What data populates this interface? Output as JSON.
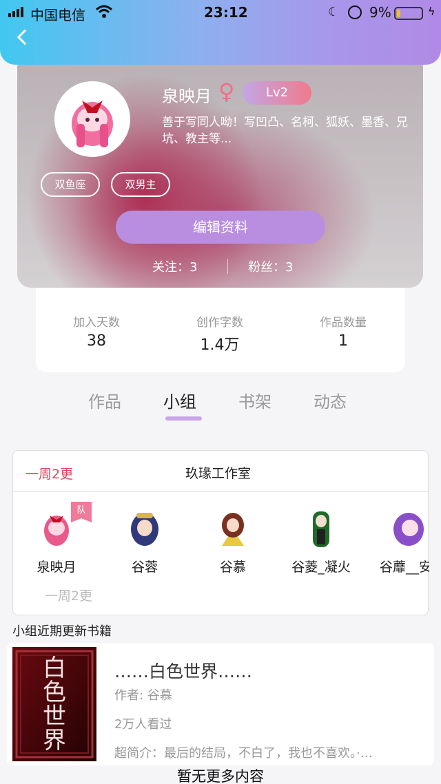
{
  "status_bar": {
    "carrier": "中国电信",
    "time": "23:12",
    "battery_percent": "9%"
  },
  "profile": {
    "name": "泉映月",
    "gender_symbol": "♀",
    "level": "Lv2",
    "bio": "善于写同人呦！写凹凸、名柯、狐妖、墨香、兄坑、教主等...",
    "tags": [
      "双鱼座",
      "双男主"
    ],
    "edit_label": "编辑资料",
    "following": "关注：3",
    "followers": "粉丝：3"
  },
  "stats": [
    {
      "label": "加入天数",
      "value": "38"
    },
    {
      "label": "创作字数",
      "value": "1.4万"
    },
    {
      "label": "作品数量",
      "value": "1"
    }
  ],
  "tabs": [
    {
      "label": "作品"
    },
    {
      "label": "小组"
    },
    {
      "label": "书架"
    },
    {
      "label": "动态"
    }
  ],
  "active_tab": "小组",
  "group": {
    "frequency": "一周2更",
    "name": "玖瑑工作室",
    "badge": "队",
    "members": [
      {
        "name": "泉映月",
        "color": "#e85a8c"
      },
      {
        "name": "谷蓉",
        "color": "#2e3a7a"
      },
      {
        "name": "谷慕",
        "color": "#7a3020"
      },
      {
        "name": "谷菱_凝火",
        "color": "#1f6a2a"
      },
      {
        "name": "谷蘼__安羽",
        "color": "#8a4ec8"
      }
    ],
    "frequency_footer": "一周2更"
  },
  "section_title": "小组近期更新书籍",
  "book": {
    "title": "……白色世界……",
    "author": "作者: 谷慕",
    "views": "2万人看过",
    "intro": "超简介：最后的结局，不白了，我也不喜欢。·…",
    "cover_text": "白色世界"
  },
  "footer": "暂无更多内容",
  "colors": {
    "accent_purple": "#b98ee0",
    "accent_red": "#e04860"
  }
}
